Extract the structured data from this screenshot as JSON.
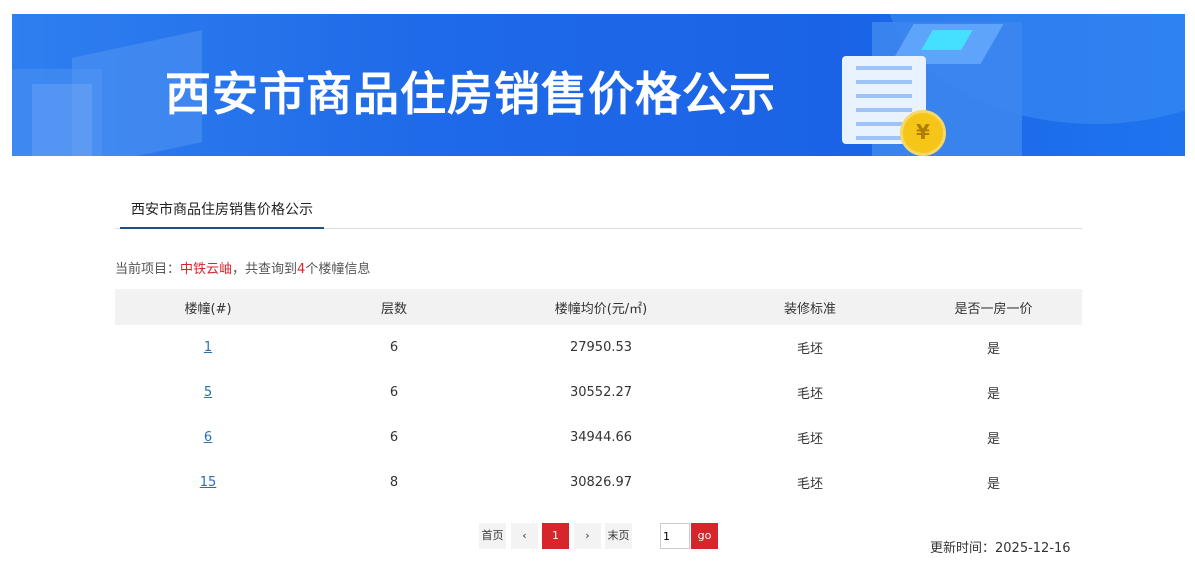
{
  "banner": {
    "title": "西安市商品住房销售价格公示"
  },
  "tabs": [
    {
      "label": "西安市商品住房销售价格公示"
    }
  ],
  "info": {
    "prefix": "当前项目：",
    "project": "中铁云岫",
    "middle": "，共查询到",
    "count": "4",
    "suffix": "个楼幢信息"
  },
  "table": {
    "headers": [
      "楼幢(#)",
      "层数",
      "楼幢均价(元/㎡)",
      "装修标准",
      "是否一房一价"
    ],
    "rows": [
      [
        "1",
        "6",
        "27950.53",
        "毛坯",
        "是"
      ],
      [
        "5",
        "6",
        "30552.27",
        "毛坯",
        "是"
      ],
      [
        "6",
        "6",
        "34944.66",
        "毛坯",
        "是"
      ],
      [
        "15",
        "8",
        "30826.97",
        "毛坯",
        "是"
      ]
    ]
  },
  "pagination": {
    "first": "首页",
    "prev": "‹",
    "current": "1",
    "next": "›",
    "last": "末页",
    "page_input": "1",
    "go": "go"
  },
  "update": {
    "label": "更新时间：",
    "date": "2025-12-16"
  },
  "colors": {
    "accent_red": "#d7262b",
    "banner_blue": "#1f6ae8",
    "link_blue": "#2a6fb5"
  }
}
